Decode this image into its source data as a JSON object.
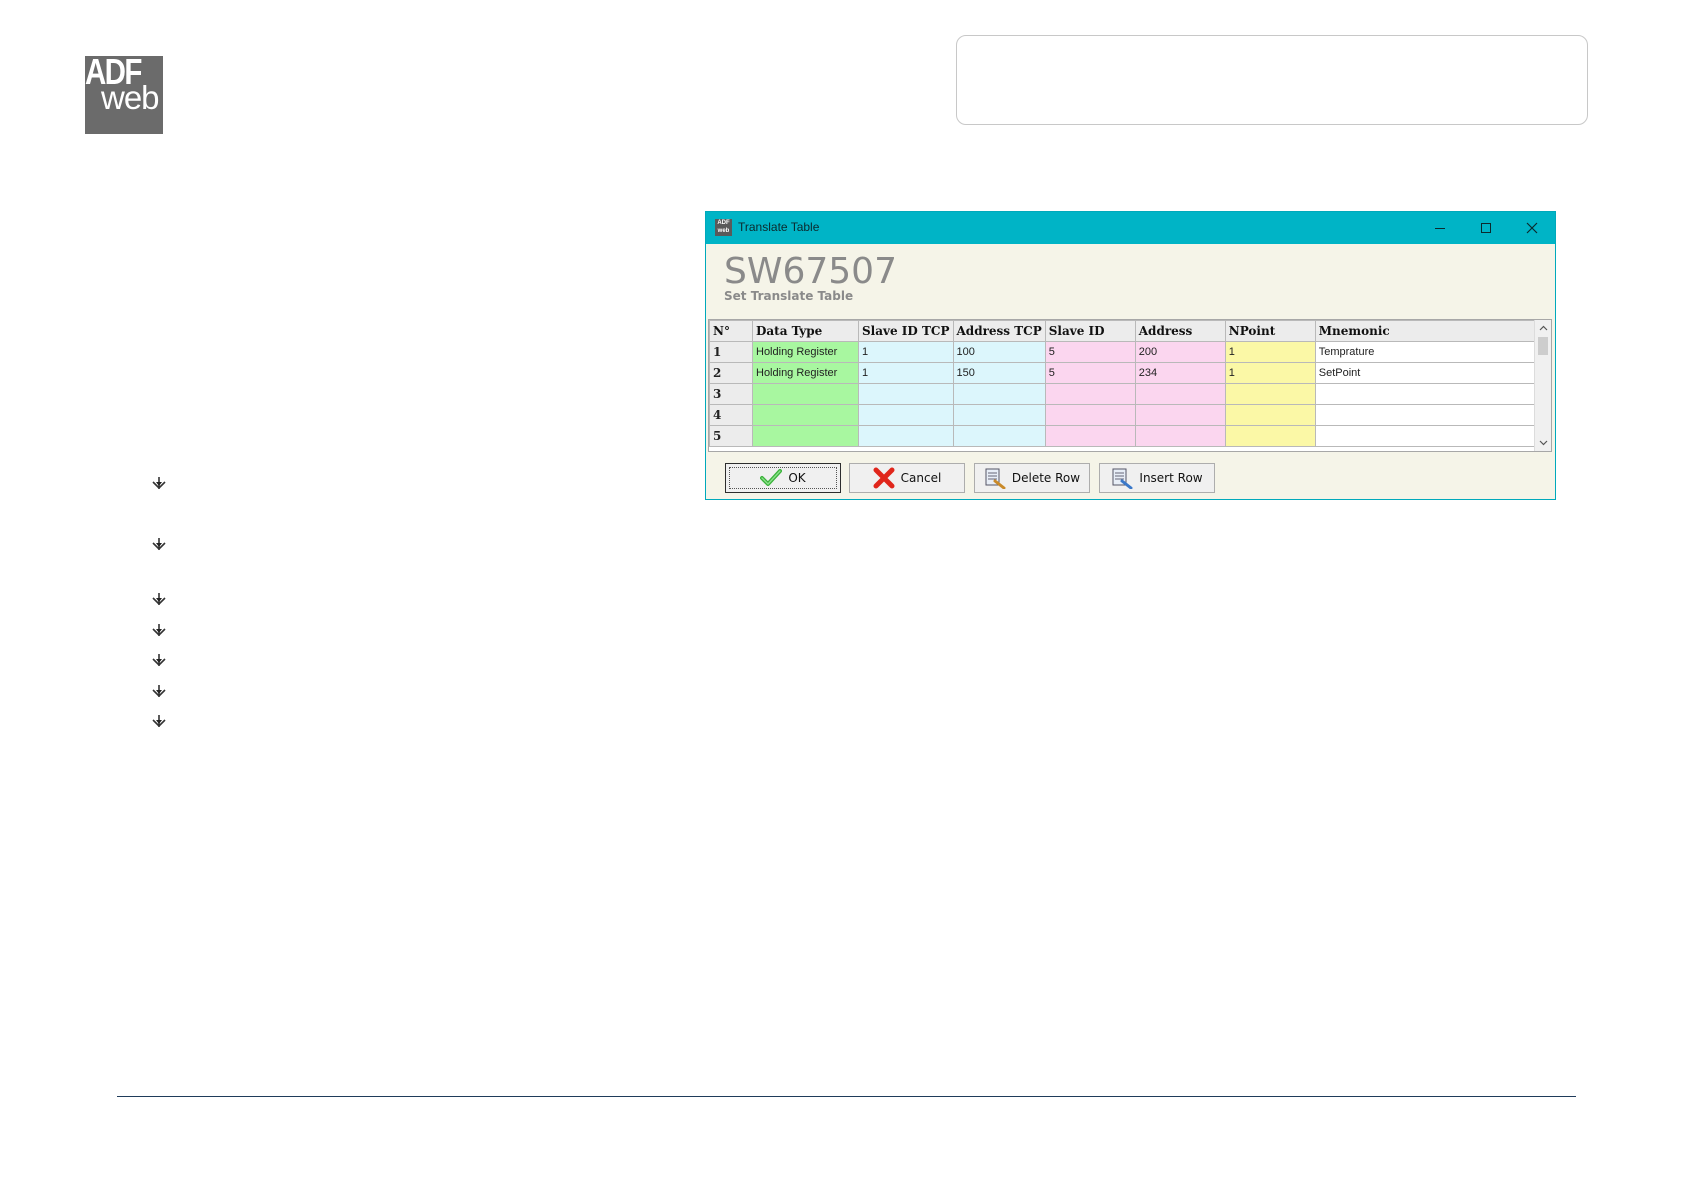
{
  "logo": {
    "line1": "ADF",
    "line2": "web"
  },
  "window": {
    "title": "Translate Table",
    "app_title": "SW67507",
    "app_subtitle": "Set Translate Table",
    "controls": {
      "minimize_icon": "minimize-icon",
      "maximize_icon": "maximize-icon",
      "close_icon": "close-icon"
    }
  },
  "table": {
    "columns": [
      "N°",
      "Data Type",
      "Slave ID TCP",
      "Address TCP",
      "Slave ID",
      "Address",
      "NPoint",
      "Mnemonic"
    ],
    "rows": [
      {
        "n": "1",
        "data_type": "Holding Register",
        "slave_id_tcp": "1",
        "address_tcp": "100",
        "slave_id": "5",
        "address": "200",
        "npoint": "1",
        "mnemonic": "Temprature"
      },
      {
        "n": "2",
        "data_type": "Holding Register",
        "slave_id_tcp": "1",
        "address_tcp": "150",
        "slave_id": "5",
        "address": "234",
        "npoint": "1",
        "mnemonic": "SetPoint"
      },
      {
        "n": "3",
        "data_type": "",
        "slave_id_tcp": "",
        "address_tcp": "",
        "slave_id": "",
        "address": "",
        "npoint": "",
        "mnemonic": ""
      },
      {
        "n": "4",
        "data_type": "",
        "slave_id_tcp": "",
        "address_tcp": "",
        "slave_id": "",
        "address": "",
        "npoint": "",
        "mnemonic": ""
      },
      {
        "n": "5",
        "data_type": "",
        "slave_id_tcp": "",
        "address_tcp": "",
        "slave_id": "",
        "address": "",
        "npoint": "",
        "mnemonic": ""
      }
    ],
    "column_colors": {
      "data_type": "#a8f7a0",
      "slave_id_tcp": "#dcf6fc",
      "address_tcp": "#dcf6fc",
      "slave_id": "#fbd6ef",
      "address": "#fbd6ef",
      "npoint": "#fbf8a6",
      "mnemonic": "#ffffff"
    }
  },
  "buttons": {
    "ok": {
      "label": "OK",
      "icon": "checkmark-icon"
    },
    "cancel": {
      "label": "Cancel",
      "icon": "red-x-icon"
    },
    "delete_row": {
      "label": "Delete Row",
      "icon": "delete-row-icon"
    },
    "insert_row": {
      "label": "Insert Row",
      "icon": "insert-row-icon"
    }
  },
  "colors": {
    "titlebar": "#00b4c6",
    "window_bg": "#f5f4e8",
    "footer_line": "#1f3b5a",
    "logo_bg": "#6b6b6b"
  }
}
